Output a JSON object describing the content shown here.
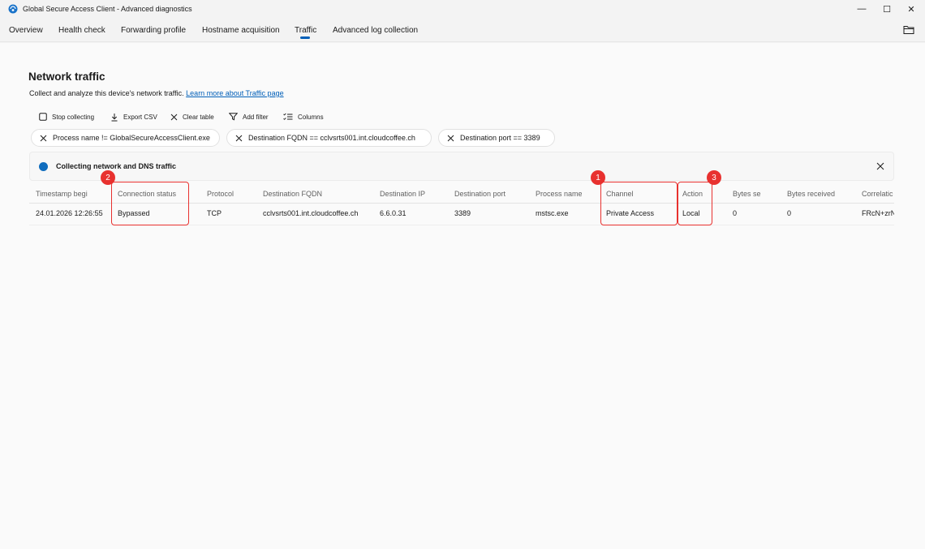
{
  "window": {
    "title": "Global Secure Access Client - Advanced diagnostics",
    "controls": {
      "minimize": "—",
      "maximize": "☐",
      "close": "✕"
    }
  },
  "tabs": [
    {
      "label": "Overview"
    },
    {
      "label": "Health check"
    },
    {
      "label": "Forwarding profile"
    },
    {
      "label": "Hostname acquisition"
    },
    {
      "label": "Traffic",
      "selected": true
    },
    {
      "label": "Advanced log collection"
    }
  ],
  "page": {
    "title": "Network traffic",
    "description": "Collect and analyze this device's network traffic.",
    "learn_more": "Learn more about Traffic page"
  },
  "toolbar": {
    "stop_collecting": "Stop collecting",
    "export_csv": "Export CSV",
    "clear_table": "Clear table",
    "add_filter": "Add filter",
    "columns": "Columns"
  },
  "filters": [
    "Process name != GlobalSecureAccessClient.exe",
    "Destination FQDN == cclvsrts001.int.cloudcoffee.ch",
    "Destination port == 3389"
  ],
  "info_bar": {
    "message": "Collecting network and DNS traffic"
  },
  "table": {
    "headers": [
      "Timestamp begi",
      "Connection status",
      "Protocol",
      "Destination FQDN",
      "Destination IP",
      "Destination port",
      "Process name",
      "Channel",
      "Action",
      "Bytes se",
      "Bytes received",
      "Correlatic"
    ],
    "rows": [
      [
        "24.01.2026 12:26:55",
        "Bypassed",
        "TCP",
        "cclvsrts001.int.cloudcoffee.ch",
        "6.6.0.31",
        "3389",
        "mstsc.exe",
        "Private Access",
        "Local",
        "0",
        "0",
        "FRcN+zrN"
      ]
    ]
  },
  "annotations": [
    {
      "number": "1",
      "target": "Channel"
    },
    {
      "number": "2",
      "target": "Connection status"
    },
    {
      "number": "3",
      "target": "Action"
    }
  ],
  "colors": {
    "accent": "#005fb8",
    "highlight": "#e8312f",
    "info_dot": "#0f6cbd"
  }
}
